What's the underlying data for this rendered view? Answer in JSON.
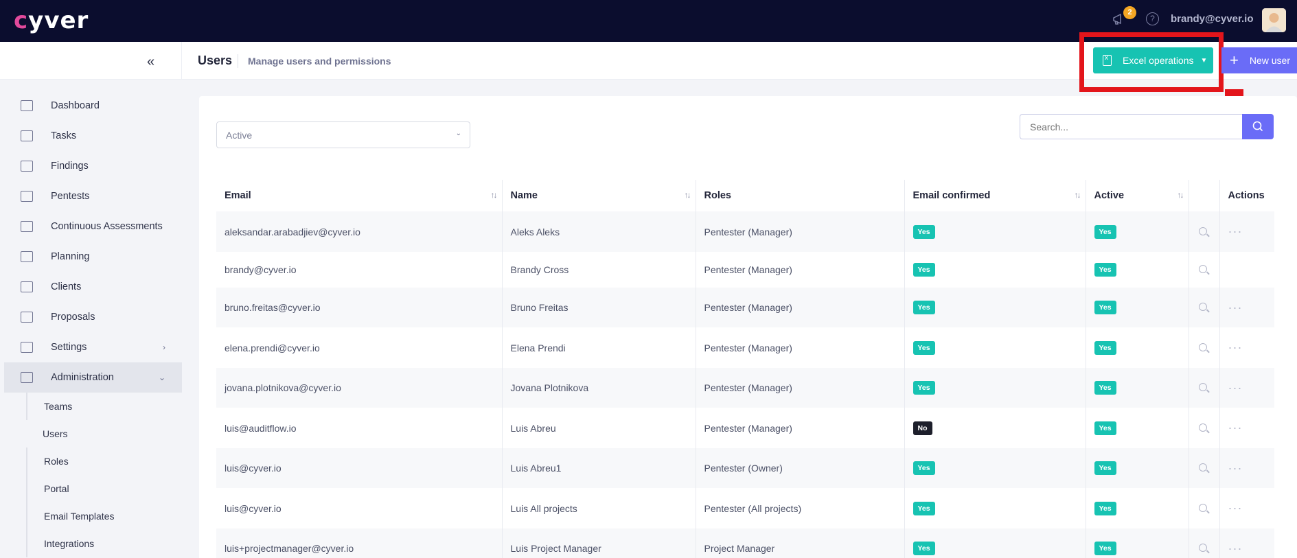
{
  "topbar": {
    "logo_text": "cyver",
    "notification_count": "2",
    "help_icon": "?",
    "user_email": "brandy@cyver.io"
  },
  "header": {
    "title": "Users",
    "subtitle": "Manage users and permissions",
    "excel_button": "Excel operations",
    "new_user_button": "New user"
  },
  "sidebar": {
    "items": [
      {
        "label": "Dashboard",
        "icon": "dashboard-icon"
      },
      {
        "label": "Tasks",
        "icon": "tasks-icon"
      },
      {
        "label": "Findings",
        "icon": "findings-icon"
      },
      {
        "label": "Pentests",
        "icon": "pentests-icon"
      },
      {
        "label": "Continuous Assessments",
        "icon": "shield-icon"
      },
      {
        "label": "Planning",
        "icon": "calendar-icon"
      },
      {
        "label": "Clients",
        "icon": "clients-icon"
      },
      {
        "label": "Proposals",
        "icon": "proposals-icon"
      },
      {
        "label": "Settings",
        "icon": "gear-icon"
      },
      {
        "label": "Administration",
        "icon": "admin-icon"
      }
    ],
    "admin_subitems": [
      "Teams",
      "Users",
      "Roles",
      "Portal",
      "Email Templates",
      "Integrations"
    ]
  },
  "filters": {
    "status_value": "Active",
    "search_placeholder": "Search..."
  },
  "table": {
    "columns": [
      "Email",
      "Name",
      "Roles",
      "Email confirmed",
      "Active",
      "",
      "Actions"
    ],
    "rows": [
      {
        "email": "aleksandar.arabadjiev@cyver.io",
        "name": "Aleks Aleks",
        "role": "Pentester (Manager)",
        "confirmed": "Yes",
        "active": "Yes",
        "actions": "···"
      },
      {
        "email": "brandy@cyver.io",
        "name": "Brandy Cross",
        "role": "Pentester (Manager)",
        "confirmed": "Yes",
        "active": "Yes",
        "actions": ""
      },
      {
        "email": "bruno.freitas@cyver.io",
        "name": "Bruno Freitas",
        "role": "Pentester (Manager)",
        "confirmed": "Yes",
        "active": "Yes",
        "actions": "···"
      },
      {
        "email": "elena.prendi@cyver.io",
        "name": "Elena Prendi",
        "role": "Pentester (Manager)",
        "confirmed": "Yes",
        "active": "Yes",
        "actions": "···"
      },
      {
        "email": "jovana.plotnikova@cyver.io",
        "name": "Jovana Plotnikova",
        "role": "Pentester (Manager)",
        "confirmed": "Yes",
        "active": "Yes",
        "actions": "···"
      },
      {
        "email": "luis@auditflow.io",
        "name": "Luis Abreu",
        "role": "Pentester (Manager)",
        "confirmed": "No",
        "active": "Yes",
        "actions": "···"
      },
      {
        "email": "luis@cyver.io",
        "name": "Luis Abreu1",
        "role": "Pentester (Owner)",
        "confirmed": "Yes",
        "active": "Yes",
        "actions": "···"
      },
      {
        "email": "luis@cyver.io",
        "name": "Luis All projects",
        "role": "Pentester (All projects)",
        "confirmed": "Yes",
        "active": "Yes",
        "actions": "···"
      },
      {
        "email": "luis+projectmanager@cyver.io",
        "name": "Luis Project Manager",
        "role": "Project Manager",
        "confirmed": "Yes",
        "active": "Yes",
        "actions": "···"
      }
    ]
  },
  "colors": {
    "topbar": "#0b0d2e",
    "teal": "#17c3b2",
    "purple": "#6a6cf7",
    "highlight": "#e3151b"
  }
}
